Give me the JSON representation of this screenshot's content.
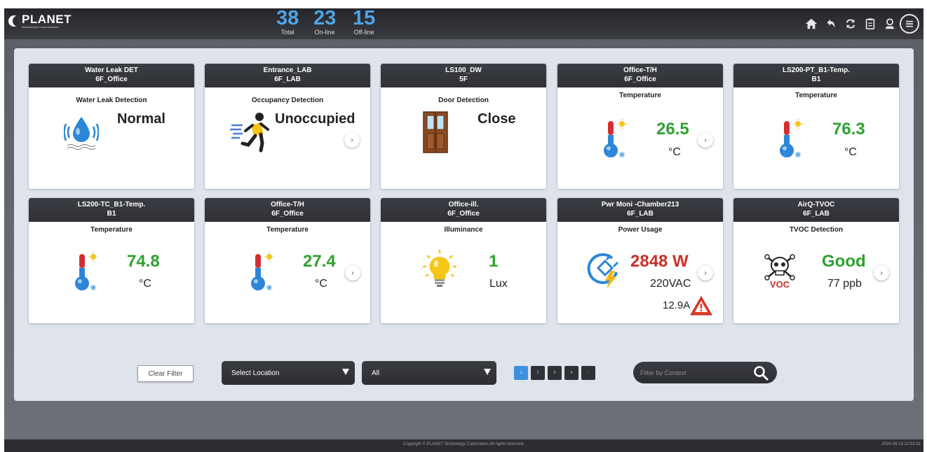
{
  "header": {
    "logo_text": "PLANET",
    "logo_subtext": "Networking & Communication",
    "counters": [
      {
        "value": "38",
        "label": "Total"
      },
      {
        "value": "23",
        "label": "On-line"
      },
      {
        "value": "15",
        "label": "Off-line"
      }
    ],
    "icons": [
      "home-icon",
      "undo-icon",
      "refresh-icon",
      "clipboard-icon",
      "user-icon",
      "menu-icon"
    ]
  },
  "cards": [
    {
      "name": "Water Leak DET",
      "location": "6F_Office",
      "type": "Water Leak Detection",
      "value": "Normal",
      "icon": "water-drop-icon"
    },
    {
      "name": "Entrance_LAB",
      "location": "6F_LAB",
      "type": "Occupancy Detection",
      "value": "Unoccupied",
      "icon": "running-person-icon"
    },
    {
      "name": "LS100_DW",
      "location": "5F",
      "type": "Door Detection",
      "value": "Close",
      "icon": "door-icon"
    },
    {
      "name": "Office-T/H",
      "location": "6F_Office",
      "type": "Temperature",
      "value": "26.5",
      "unit": "°C",
      "icon": "thermometer-icon"
    },
    {
      "name": "LS200-PT_B1-Temp.",
      "location": "B1",
      "type": "Temperature",
      "value": "76.3",
      "unit": "°C",
      "icon": "thermometer-icon"
    },
    {
      "name": "LS200-TC_B1-Temp.",
      "location": "B1",
      "type": "Temperature",
      "value": "74.8",
      "unit": "°C",
      "icon": "thermometer-icon"
    },
    {
      "name": "Office-T/H",
      "location": "6F_Office",
      "type": "Temperature",
      "value": "27.4",
      "unit": "°C",
      "icon": "thermometer-icon"
    },
    {
      "name": "Office-ill.",
      "location": "6F_Office",
      "type": "Illuminance",
      "value": "1",
      "unit": "Lux",
      "icon": "light-bulb-icon"
    },
    {
      "name": "Pwr Moni -Chamber213",
      "location": "6F_LAB",
      "type": "Power Usage",
      "value": "2848 W",
      "unit": "220VAC",
      "extra": "12.9A",
      "icon": "power-plug-icon"
    },
    {
      "name": "AirQ-TVOC",
      "location": "6F_LAB",
      "type": "TVOC Detection",
      "value": "Good",
      "unit": "77 ppb",
      "icon": "voc-skull-icon",
      "icon_text": "VOC"
    }
  ],
  "filters": {
    "clear_label": "Clear Filter",
    "location_select": "Select Location",
    "category_select": "All",
    "pages": [
      "1",
      "2",
      "3",
      "4",
      "›"
    ],
    "search_placeholder": "Filter by Context"
  },
  "footer": {
    "copyright": "Copyright © PLANET Technology Corporation.All rights reserved.",
    "timestamp": "2024-08-13 22:53:31"
  },
  "colors": {
    "accent_blue": "#4ea3e6",
    "value_green": "#2ea12e",
    "value_red": "#c8302a",
    "header_dark": "#2f3136"
  }
}
